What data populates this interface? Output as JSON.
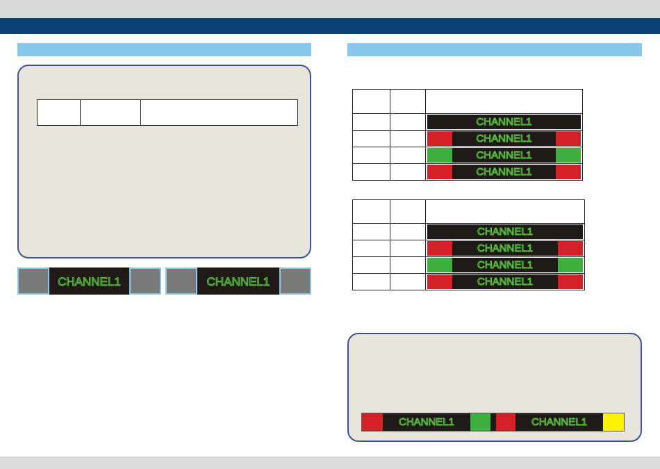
{
  "channel_label": "CHANNEL1",
  "colors": {
    "header_blue": "#0c3f74",
    "section_blue": "#88c8ea",
    "panel_beige": "#e8e5dc",
    "panel_border": "#3e4f9d",
    "lcd_text": "#5fcc3e",
    "red": "#d42026",
    "green": "#3db040",
    "yellow": "#fff200",
    "gray": "#7a7a7a"
  },
  "tables": [
    {
      "rows": [
        {
          "left": "none",
          "right": "none"
        },
        {
          "left": "red",
          "right": "red"
        },
        {
          "left": "green",
          "right": "green"
        },
        {
          "left": "red",
          "right": "red"
        }
      ]
    },
    {
      "rows": [
        {
          "left": "none",
          "right": "none"
        },
        {
          "left": "red",
          "right": "red"
        },
        {
          "left": "green",
          "right": "green"
        },
        {
          "left": "red",
          "right": "red"
        }
      ]
    }
  ],
  "bottom_strip": {
    "blocks": [
      "red",
      "green",
      "red",
      "yellow"
    ]
  },
  "left_strip": {
    "blocks": [
      "gray",
      "gray",
      "gray",
      "gray"
    ]
  }
}
